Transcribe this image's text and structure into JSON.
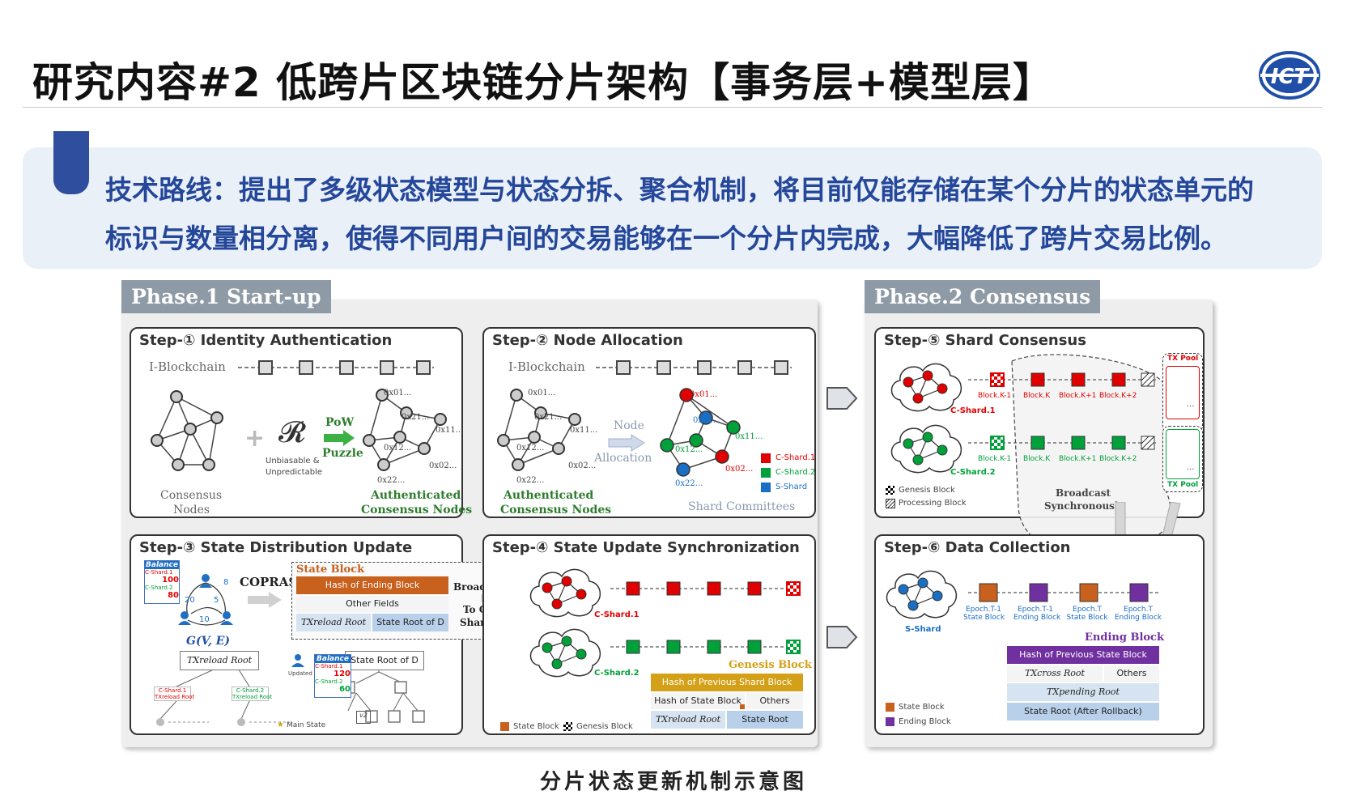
{
  "title": "研究内容#2 低跨片区块链分片架构【事务层+模型层】",
  "logo_text": "ICT",
  "route_line1": "技术路线：提出了多级状态模型与状态分拆、聚合机制，将目前仅能存储在某个分片的状态单元的",
  "route_line2": "标识与数量相分离，使得不同用户间的交易能够在一个分片内完成，大幅降低了跨片交易比例。",
  "caption": "分片状态更新机制示意图",
  "phase1": {
    "label": "Phase.1 Start-up",
    "step1": {
      "title": "Step-① Identity Authentication",
      "iblock": "I-Blockchain",
      "consensus": "Consensus",
      "nodes": "Nodes",
      "r_symbol": "𝓡",
      "unbiasable": "Unbiasable &",
      "unpredictable": "Unpredictable",
      "pow": "PoW",
      "puzzle": "Puzzle",
      "auth1": "Authenticated",
      "auth2": "Consensus Nodes",
      "ids": [
        "0x01...",
        "0x21...",
        "0x11...",
        "0x12...",
        "0x02...",
        "0x22..."
      ]
    },
    "step2": {
      "title": "Step-② Node Allocation",
      "iblock": "I-Blockchain",
      "node": "Node",
      "allocation": "Allocation",
      "auth1": "Authenticated",
      "auth2": "Consensus Nodes",
      "committees": "Shard Committees",
      "ids": [
        "0x01...",
        "0x21...",
        "0x11...",
        "0x12...",
        "0x02...",
        "0x22..."
      ],
      "legend": [
        "C-Shard.1",
        "C-Shard.2",
        "S-Shard"
      ]
    },
    "step3": {
      "title": "Step-③ State Distribution Update",
      "balance": "Balance",
      "cs1": "C-Shard.1",
      "cs2": "C-Shard.2",
      "v100": "100",
      "v80": "80",
      "copras": "COPRAS",
      "graph": "G(V, E)",
      "edge_nums": [
        "8",
        "20",
        "5",
        "10"
      ],
      "state_block": "State Block",
      "hash_end": "Hash of Ending Block",
      "other_fields": "Other Fields",
      "tx_reload_root": "TXreload Root",
      "state_root_d": "State Root of D",
      "broadcast": "Broadcast",
      "to_cshards": "To C-",
      "shards": "Shards",
      "tree_root": "TXreload Root",
      "tree_state": "State Root of D",
      "updated": "Updated",
      "v120": "120",
      "v60": "60",
      "leaf1": "C-Shard.1",
      "leaf1b": "TXreload Root",
      "leaf2": "C-Shard.2",
      "leaf2b": "TXreload Root",
      "main_state": "Main State",
      "v2": "v2"
    },
    "step4": {
      "title": "Step-④ State Update Synchronization",
      "cs1": "C-Shard.1",
      "cs2": "C-Shard.2",
      "genesis": "Genesis Block",
      "hash_prev": "Hash of Previous Shard Block",
      "hash_state": "Hash of State Block",
      "others": "Others",
      "tx_reload_root": "TXreload Root",
      "state_root": "State Root",
      "legend_state": "State Block",
      "legend_genesis": "Genesis Block"
    }
  },
  "phase2": {
    "label": "Phase.2 Consensus",
    "step5": {
      "title": "Step-⑤ Shard Consensus",
      "tx_pool": "TX Pool",
      "blocks": [
        "Block.K-1",
        "Block.K",
        "Block.K+1",
        "Block.K+2"
      ],
      "cs1": "C-Shard.1",
      "cs2": "C-Shard.2",
      "legend_genesis": "Genesis Block",
      "legend_processing": "Processing Block",
      "broadcast": "Broadcast",
      "sync": "Synchronously",
      "dots": "..."
    },
    "step6": {
      "title": "Step-⑥ Data Collection",
      "sshard": "S-Shard",
      "labels": [
        [
          "Epoch.T-1",
          "State Block"
        ],
        [
          "Epoch.T-1",
          "Ending Block"
        ],
        [
          "Epoch.T",
          "State Block"
        ],
        [
          "Epoch.T",
          "Ending Block"
        ]
      ],
      "ending_block": "Ending Block",
      "hash_prev_state": "Hash of Previous State Block",
      "tx_cross_root": "TXcross Root",
      "others": "Others",
      "tx_pending_root": "TXpending Root",
      "state_root_after": "State Root (After Rollback)",
      "legend_state": "State Block",
      "legend_ending": "Ending Block"
    }
  },
  "colors": {
    "accent": "#24479a",
    "red": "#e00000",
    "green": "#00a03a",
    "blue": "#1a6fc4",
    "orange": "#c8601e",
    "purple": "#7030a0",
    "gold": "#d4a017",
    "phase_tab": "#8e9aa6"
  }
}
